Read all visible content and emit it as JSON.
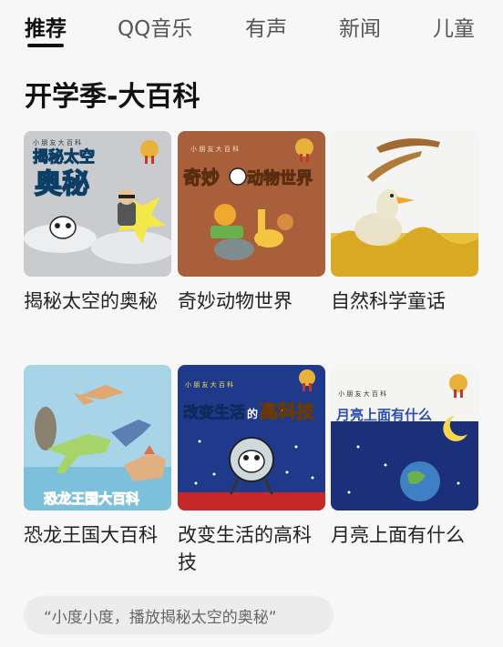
{
  "tabs": [
    {
      "label": "推荐",
      "active": true
    },
    {
      "label": "QQ音乐",
      "active": false
    },
    {
      "label": "有声",
      "active": false
    },
    {
      "label": "新闻",
      "active": false
    },
    {
      "label": "儿童",
      "active": false
    }
  ],
  "section": {
    "title": "开学季-大百科",
    "cards": [
      {
        "title": "揭秘太空的奥秘",
        "cover_header": "小  朋  友  大  百  科",
        "cover_text_1": "揭秘太空",
        "cover_text_2": "奥秘"
      },
      {
        "title": "奇妙动物世界",
        "cover_header": "小  朋  友  大  百  科",
        "cover_text_1": "奇妙",
        "cover_text_2": "动物世界"
      },
      {
        "title": "自然科学童话"
      },
      {
        "title": "恐龙王国大百科",
        "cover_text_1": "恐龙王国大百科"
      },
      {
        "title": "改变生活的高科技",
        "cover_header": "小 朋 友 大 百 科",
        "cover_text_1": "改变生活",
        "cover_text_2": "的",
        "cover_text_3": "高科技"
      },
      {
        "title": "月亮上面有什么",
        "cover_header": "小  朋  友  大  百  科",
        "cover_text_1": "月亮上面有什么"
      }
    ]
  },
  "voice_hint": "“小度小度，播放揭秘太空的奥秘”",
  "colors": {
    "background": "#f7f7f7",
    "text": "#222222",
    "hint_bg": "#ececec"
  }
}
